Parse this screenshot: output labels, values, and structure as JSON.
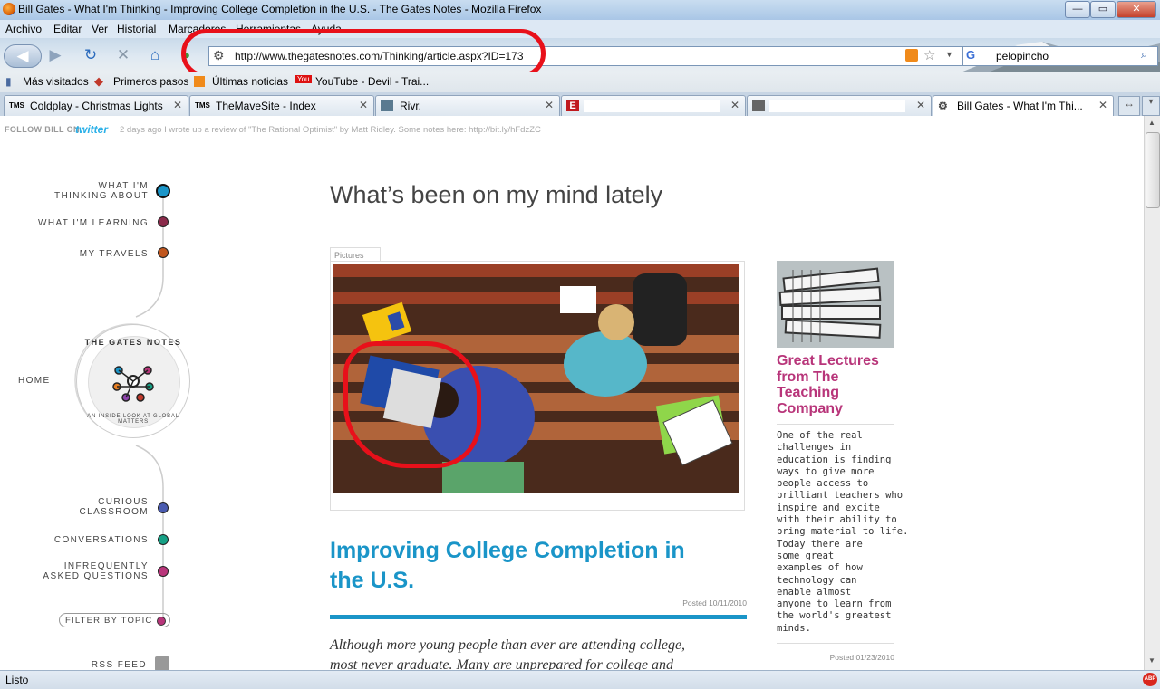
{
  "window": {
    "title": "Bill Gates - What I'm Thinking - Improving College Completion in the U.S. - The Gates Notes - Mozilla Firefox"
  },
  "menu": [
    "Archivo",
    "Editar",
    "Ver",
    "Historial",
    "Marcadores",
    "Herramientas",
    "Ayuda"
  ],
  "nav": {
    "url": "http://www.thegatesnotes.com/Thinking/article.aspx?ID=173",
    "search_value": "pelopincho"
  },
  "bookmarks": [
    "Más visitados",
    "Primeros pasos",
    "Últimas noticias",
    "YouTube - Devil - Trai..."
  ],
  "tabs": [
    {
      "label": "Coldplay - Christmas Lights",
      "fav": "TMS"
    },
    {
      "label": "TheMaveSite - Index",
      "fav": "TMS"
    },
    {
      "label": "Rivr.",
      "fav": ""
    },
    {
      "label": "",
      "fav": "E"
    },
    {
      "label": "",
      "fav": ""
    },
    {
      "label": "Bill Gates - What I'm Thi...",
      "fav": ""
    }
  ],
  "twitter": {
    "follow": "FOLLOW BILL ON",
    "brand": "twitter",
    "tweet": "2 days ago I wrote up a review of \"The Rational Optimist\" by Matt Ridley. Some notes here: http://bit.ly/hFdzZC"
  },
  "sidenav": {
    "thinking_1": "WHAT I'M",
    "thinking_2": "THINKING ABOUT",
    "learning": "WHAT I'M LEARNING",
    "travels": "MY TRAVELS",
    "home": "HOME",
    "logo_top": "THE GATES NOTES",
    "logo_bottom": "AN INSIDE LOOK AT GLOBAL MATTERS",
    "curious_1": "CURIOUS",
    "curious_2": "CLASSROOM",
    "conversations": "CONVERSATIONS",
    "faq_1": "INFREQUENTLY",
    "faq_2": "ASKED QUESTIONS",
    "filter": "FILTER BY TOPIC",
    "rss": "RSS FEED"
  },
  "main": {
    "heading": "What’s been on my mind lately",
    "image_tag": "Pictures",
    "article_title_1": "Improving College Completion in",
    "article_title_2": "the U.S.",
    "posted": "Posted 10/11/2010",
    "intro_1": "Although more young people than ever are attending college,",
    "intro_2": "most never graduate. Many are unprepared for college and"
  },
  "side": {
    "title_1": "Great Lectures",
    "title_2": "from The",
    "title_3": "Teaching",
    "title_4": "Company",
    "body": [
      "One of the real",
      "challenges in",
      "education is finding",
      "ways to give more",
      "people access to",
      "brilliant teachers who",
      "inspire and excite",
      "with their ability to",
      "bring material to life.",
      "Today there are",
      "some great",
      "examples of how",
      "technology can",
      "enable almost",
      "anyone to learn from",
      "the world's greatest",
      "minds."
    ],
    "posted": "Posted 01/23/2010"
  },
  "status": {
    "text": "Listo"
  },
  "colors": {
    "accent_blue": "#1a95c8",
    "accent_pink": "#b8357a",
    "annotation_red": "#e8101a"
  }
}
